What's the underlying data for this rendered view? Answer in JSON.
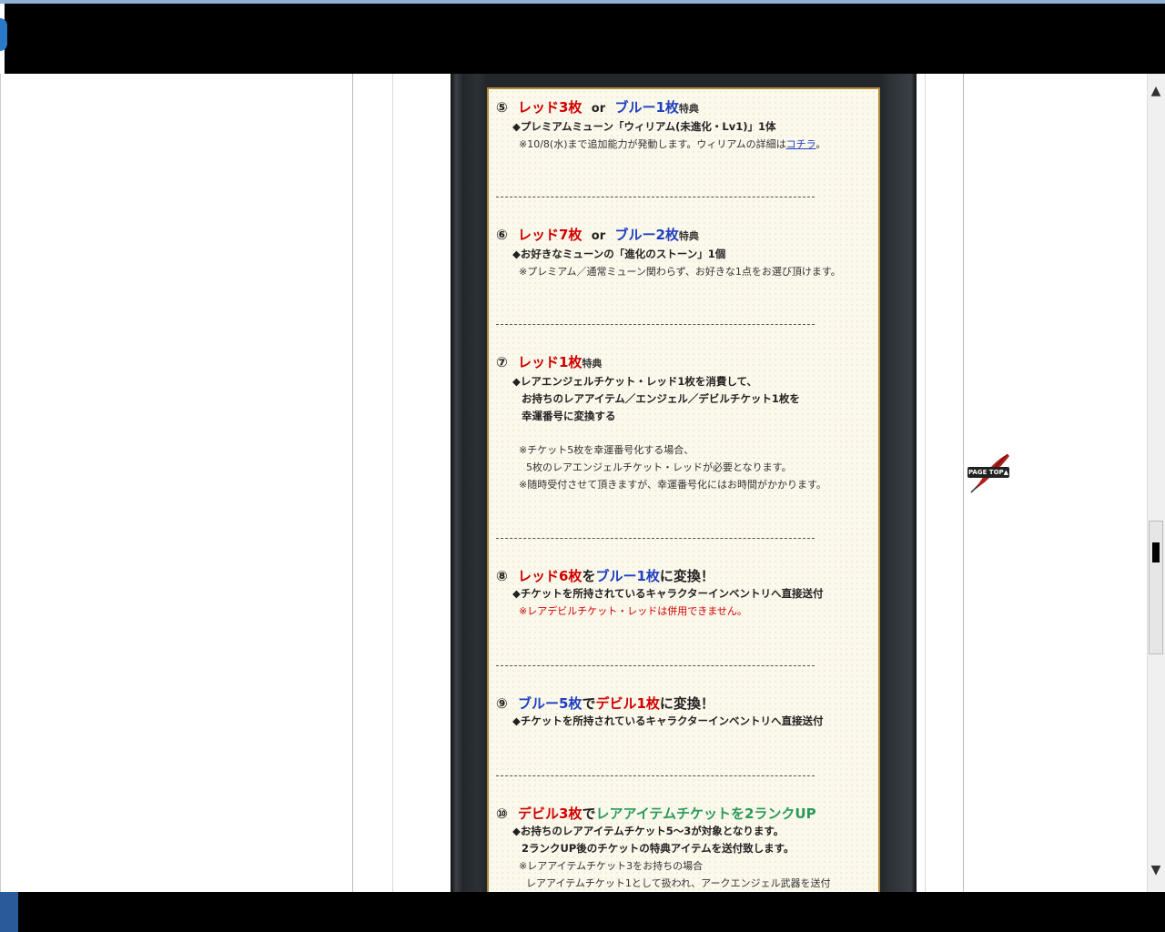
{
  "sections": [
    {
      "num": "⑤",
      "red_label": "レッド3枚",
      "or": "or",
      "blue_label": "ブルー1枚",
      "suffix": "特典",
      "bullet": "◆プレミアムミューン「ウィリアム(未進化・Lv1)」1体",
      "note_before_link": "※10/8(水)まで追加能力が発動します。ウィリアムの詳細は",
      "link": "コチラ",
      "note_after_link": "。"
    },
    {
      "num": "⑥",
      "red_label": "レッド7枚",
      "or": "or",
      "blue_label": "ブルー2枚",
      "suffix": "特典",
      "bullet": "◆お好きなミューンの「進化のストーン」1個",
      "note": "※プレミアム／通常ミューン関わらず、お好きな1点をお選び頂けます。"
    },
    {
      "num": "⑦",
      "red_label": "レッド1枚",
      "suffix": "特典",
      "bullet_lines": [
        "◆レアエンジェルチケット・レッド1枚を消費して、",
        "お持ちのレアアイテム／エンジェル／デビルチケット1枚を",
        "幸運番号に変換する"
      ],
      "notes": [
        "※チケット5枚を幸運番号化する場合、",
        "5枚のレアエンジェルチケット・レッドが必要となります。",
        "※随時受付させて頂きますが、幸運番号化にはお時間がかかります。"
      ]
    },
    {
      "num": "⑧",
      "part1": "レッド6枚",
      "part2": "を",
      "part3": "ブルー1枚",
      "part4": "に変換！",
      "bullet": "◆チケットを所持されているキャラクターインベントリへ直接送付",
      "note_red": "※レアデビルチケット・レッドは併用できません。"
    },
    {
      "num": "⑨",
      "part1": "ブルー5枚",
      "part2": "で",
      "part3": "デビル1枚",
      "part4": "に変換！",
      "bullet": "◆チケットを所持されているキャラクターインベントリへ直接送付"
    },
    {
      "num": "⑩",
      "part1": "デビル3枚",
      "part2": "で",
      "part3": "レアアイテムチケットを2ランクUP",
      "bullet_lines": [
        "◆お持ちのレアアイテムチケット5～3が対象となります。",
        "2ランクUP後のチケットの特典アイテムを送付致します。"
      ],
      "notes": [
        "※レアアイテムチケット3をお持ちの場合",
        "レアアイテムチケット1として扱われ、アークエンジェル武器を送付"
      ]
    }
  ],
  "page_top": {
    "label": "PAGE TOP▲"
  },
  "scrollbar": {
    "up": "▲",
    "down": "▼"
  },
  "colors": {
    "red": "#d00000",
    "blue": "#1f3fc0",
    "green": "#2a9a5a",
    "frame_gold": "#b08a3a"
  }
}
